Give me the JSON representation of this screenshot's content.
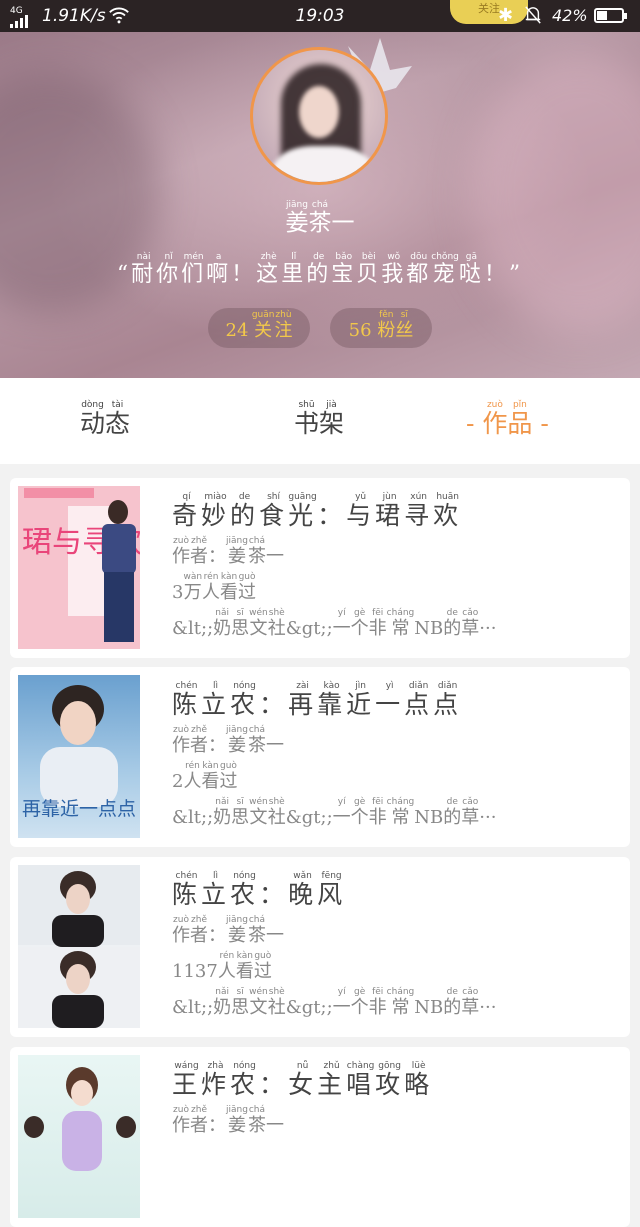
{
  "status_bar": {
    "network": "4G",
    "speed": "1.91K/s",
    "time": "19:03",
    "battery_percent": "42%",
    "battery_level": 0.42,
    "notification_pill": "关注"
  },
  "profile": {
    "username": [
      {
        "t": "姜",
        "p": "jiāng"
      },
      {
        "t": "茶",
        "p": "chá"
      },
      {
        "t": "一",
        "p": ""
      }
    ],
    "quote": [
      {
        "t": "“",
        "p": ""
      },
      {
        "t": "耐",
        "p": "nài"
      },
      {
        "t": "你",
        "p": "nǐ"
      },
      {
        "t": "们",
        "p": "mén"
      },
      {
        "t": "啊",
        "p": "a"
      },
      {
        "t": "！",
        "p": ""
      },
      {
        "t": "这",
        "p": "zhè"
      },
      {
        "t": "里",
        "p": "lǐ"
      },
      {
        "t": "的",
        "p": "de"
      },
      {
        "t": "宝",
        "p": "bǎo"
      },
      {
        "t": "贝",
        "p": "bèi"
      },
      {
        "t": "我",
        "p": "wǒ"
      },
      {
        "t": "都",
        "p": "dōu"
      },
      {
        "t": "宠",
        "p": "chǒng"
      },
      {
        "t": "哒",
        "p": "gā"
      },
      {
        "t": "！",
        "p": ""
      },
      {
        "t": "”",
        "p": ""
      }
    ],
    "follow_count": "24",
    "follow_label": [
      {
        "t": "关",
        "p": "guān"
      },
      {
        "t": "注",
        "p": "zhù"
      }
    ],
    "fans_count": "56",
    "fans_label": [
      {
        "t": "粉",
        "p": "fěn"
      },
      {
        "t": "丝",
        "p": "sī"
      }
    ]
  },
  "tabs": {
    "dynamic": [
      {
        "t": "动",
        "p": "dòng"
      },
      {
        "t": "态",
        "p": "tài"
      }
    ],
    "shelf": [
      {
        "t": "书",
        "p": "shū"
      },
      {
        "t": "架",
        "p": "jià"
      }
    ],
    "works": [
      {
        "t": "-",
        "p": ""
      },
      {
        "t": " ",
        "p": ""
      },
      {
        "t": "作",
        "p": "zuò"
      },
      {
        "t": "品",
        "p": "pǐn"
      },
      {
        "t": " ",
        "p": ""
      },
      {
        "t": "-",
        "p": ""
      }
    ]
  },
  "books": [
    {
      "title": [
        {
          "t": "奇",
          "p": "qí"
        },
        {
          "t": "妙",
          "p": "miào"
        },
        {
          "t": "的",
          "p": "de"
        },
        {
          "t": "食",
          "p": "shí"
        },
        {
          "t": "光",
          "p": "guāng"
        },
        {
          "t": "：",
          "p": ""
        },
        {
          "t": "与",
          "p": "yǔ"
        },
        {
          "t": "珺",
          "p": "jùn"
        },
        {
          "t": "寻",
          "p": "xún"
        },
        {
          "t": "欢",
          "p": "huān"
        }
      ],
      "author": [
        {
          "t": "作",
          "p": "zuò"
        },
        {
          "t": "者",
          "p": "zhě"
        },
        {
          "t": "：",
          "p": ""
        },
        {
          "t": "姜",
          "p": "jiāng"
        },
        {
          "t": "茶",
          "p": "chá"
        },
        {
          "t": "一",
          "p": ""
        }
      ],
      "views": [
        {
          "t": "3",
          "p": ""
        },
        {
          "t": "万",
          "p": "wàn"
        },
        {
          "t": "人",
          "p": "rén"
        },
        {
          "t": "看",
          "p": "kàn"
        },
        {
          "t": "过",
          "p": "guò"
        }
      ],
      "publisher": [
        {
          "t": "&lt;;",
          "p": ""
        },
        {
          "t": "奶",
          "p": "nǎi"
        },
        {
          "t": "思",
          "p": "sī"
        },
        {
          "t": "文",
          "p": "wén"
        },
        {
          "t": "社",
          "p": "shè"
        },
        {
          "t": "&gt;;",
          "p": ""
        },
        {
          "t": "一",
          "p": "yí"
        },
        {
          "t": "个",
          "p": "gè"
        },
        {
          "t": "非",
          "p": "fēi"
        },
        {
          "t": "常",
          "p": "cháng"
        },
        {
          "t": "NB",
          "p": ""
        },
        {
          "t": "的",
          "p": "de"
        },
        {
          "t": "草",
          "p": "cǎo"
        },
        {
          "t": "···",
          "p": ""
        }
      ],
      "cover_text": "珺与寻欢"
    },
    {
      "title": [
        {
          "t": "陈",
          "p": "chén"
        },
        {
          "t": "立",
          "p": "lì"
        },
        {
          "t": "农",
          "p": "nóng"
        },
        {
          "t": "：",
          "p": ""
        },
        {
          "t": "再",
          "p": "zài"
        },
        {
          "t": "靠",
          "p": "kào"
        },
        {
          "t": "近",
          "p": "jìn"
        },
        {
          "t": "一",
          "p": "yì"
        },
        {
          "t": "点",
          "p": "diǎn"
        },
        {
          "t": "点",
          "p": "diǎn"
        }
      ],
      "author": [
        {
          "t": "作",
          "p": "zuò"
        },
        {
          "t": "者",
          "p": "zhě"
        },
        {
          "t": "：",
          "p": ""
        },
        {
          "t": "姜",
          "p": "jiāng"
        },
        {
          "t": "茶",
          "p": "chá"
        },
        {
          "t": "一",
          "p": ""
        }
      ],
      "views": [
        {
          "t": "2",
          "p": ""
        },
        {
          "t": "人",
          "p": "rén"
        },
        {
          "t": "看",
          "p": "kàn"
        },
        {
          "t": "过",
          "p": "guò"
        }
      ],
      "publisher": [
        {
          "t": "&lt;;",
          "p": ""
        },
        {
          "t": "奶",
          "p": "nǎi"
        },
        {
          "t": "思",
          "p": "sī"
        },
        {
          "t": "文",
          "p": "wén"
        },
        {
          "t": "社",
          "p": "shè"
        },
        {
          "t": "&gt;;",
          "p": ""
        },
        {
          "t": "一",
          "p": "yí"
        },
        {
          "t": "个",
          "p": "gè"
        },
        {
          "t": "非",
          "p": "fēi"
        },
        {
          "t": "常",
          "p": "cháng"
        },
        {
          "t": "NB",
          "p": ""
        },
        {
          "t": "的",
          "p": "de"
        },
        {
          "t": "草",
          "p": "cǎo"
        },
        {
          "t": "···",
          "p": ""
        }
      ],
      "cover_text": "再靠近一点点"
    },
    {
      "title": [
        {
          "t": "陈",
          "p": "chén"
        },
        {
          "t": "立",
          "p": "lì"
        },
        {
          "t": "农",
          "p": "nóng"
        },
        {
          "t": "：",
          "p": ""
        },
        {
          "t": "晚",
          "p": "wǎn"
        },
        {
          "t": "风",
          "p": "fēng"
        }
      ],
      "author": [
        {
          "t": "作",
          "p": "zuò"
        },
        {
          "t": "者",
          "p": "zhě"
        },
        {
          "t": "：",
          "p": ""
        },
        {
          "t": "姜",
          "p": "jiāng"
        },
        {
          "t": "茶",
          "p": "chá"
        },
        {
          "t": "一",
          "p": ""
        }
      ],
      "views": [
        {
          "t": "1137",
          "p": ""
        },
        {
          "t": "人",
          "p": "rén"
        },
        {
          "t": "看",
          "p": "kàn"
        },
        {
          "t": "过",
          "p": "guò"
        }
      ],
      "publisher": [
        {
          "t": "&lt;;",
          "p": ""
        },
        {
          "t": "奶",
          "p": "nǎi"
        },
        {
          "t": "思",
          "p": "sī"
        },
        {
          "t": "文",
          "p": "wén"
        },
        {
          "t": "社",
          "p": "shè"
        },
        {
          "t": "&gt;;",
          "p": ""
        },
        {
          "t": "一",
          "p": "yí"
        },
        {
          "t": "个",
          "p": "gè"
        },
        {
          "t": "非",
          "p": "fēi"
        },
        {
          "t": "常",
          "p": "cháng"
        },
        {
          "t": "NB",
          "p": ""
        },
        {
          "t": "的",
          "p": "de"
        },
        {
          "t": "草",
          "p": "cǎo"
        },
        {
          "t": "···",
          "p": ""
        }
      ],
      "cover_text": ""
    },
    {
      "title": [
        {
          "t": "王",
          "p": "wáng"
        },
        {
          "t": "炸",
          "p": "zhà"
        },
        {
          "t": "农",
          "p": "nóng"
        },
        {
          "t": "：",
          "p": ""
        },
        {
          "t": "女",
          "p": "nǚ"
        },
        {
          "t": "主",
          "p": "zhǔ"
        },
        {
          "t": "唱",
          "p": "chàng"
        },
        {
          "t": "攻",
          "p": "gōng"
        },
        {
          "t": "略",
          "p": "lüè"
        }
      ],
      "author": [
        {
          "t": "作",
          "p": "zuò"
        },
        {
          "t": "者",
          "p": "zhě"
        },
        {
          "t": "：",
          "p": ""
        },
        {
          "t": "姜",
          "p": "jiāng"
        },
        {
          "t": "茶",
          "p": "chá"
        },
        {
          "t": "一",
          "p": ""
        }
      ],
      "views": [],
      "publisher": [],
      "cover_text": ""
    }
  ],
  "colors": {
    "accent": "#f0964a",
    "stat_text": "#f2c84a",
    "status_bar_bg": "#2b2324"
  },
  "icons": [
    "signal-icon",
    "wifi-icon",
    "bluetooth-icon",
    "bell-muted-icon",
    "battery-icon",
    "crown-icon"
  ]
}
